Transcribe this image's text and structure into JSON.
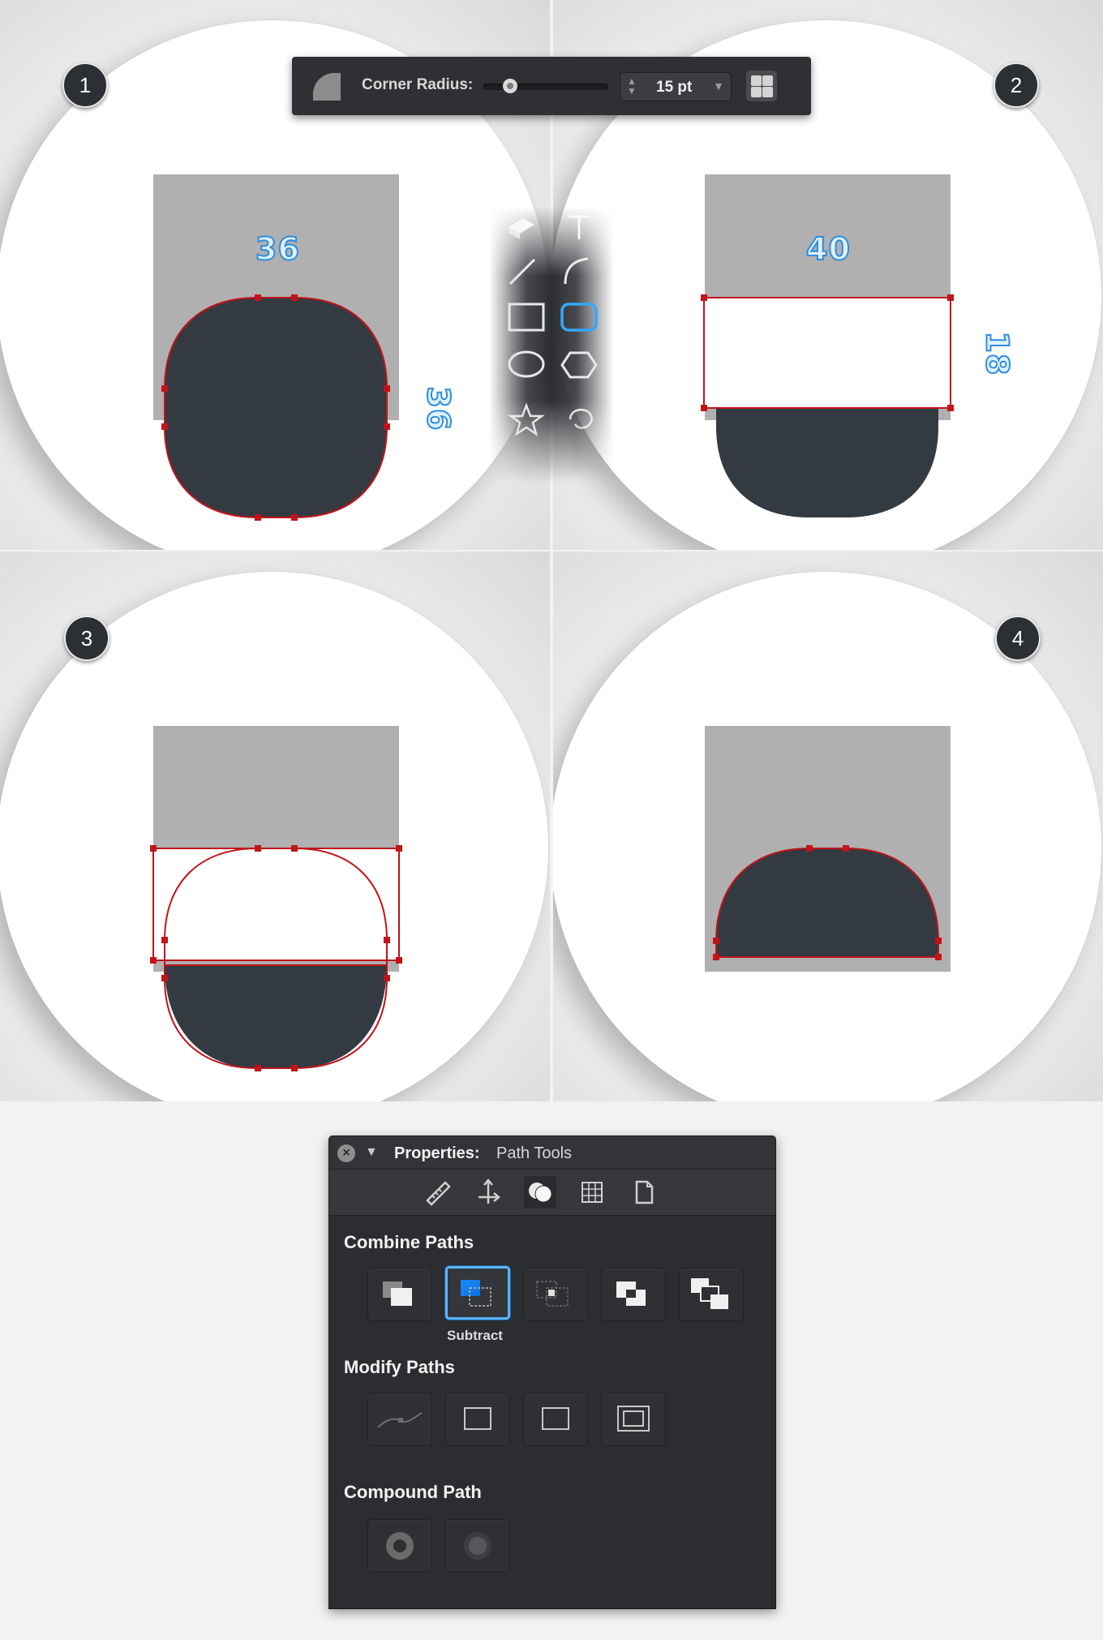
{
  "toolbar": {
    "corner_radius_label": "Corner Radius:",
    "corner_radius_value": "15 pt",
    "corner_radius_slider": 0.18
  },
  "steps": [
    {
      "number": "1",
      "measure_h": "36",
      "measure_v": "36"
    },
    {
      "number": "2",
      "measure_h": "40",
      "measure_v": "18"
    },
    {
      "number": "3"
    },
    {
      "number": "4"
    }
  ],
  "toolstrip": {
    "icons": [
      "eraser-icon",
      "text-tool-icon",
      "line-tool-icon",
      "arc-tool-icon",
      "rectangle-tool-icon",
      "rounded-rectangle-tool-icon",
      "ellipse-tool-icon",
      "polygon-tool-icon",
      "star-tool-icon",
      "spiral-tool-icon"
    ],
    "active": "rounded-rectangle-tool-icon"
  },
  "properties": {
    "title": "Properties:",
    "subtitle": "Path Tools",
    "tabs": [
      "ruler-icon",
      "move-arrows-icon",
      "combine-shapes-icon",
      "grid-icon",
      "document-icon"
    ],
    "active_tab": "combine-shapes-icon",
    "combine_paths": {
      "heading": "Combine Paths",
      "buttons": [
        "union-icon",
        "subtract-icon",
        "intersect-icon",
        "exclude-icon",
        "divide-icon"
      ],
      "selected": "subtract-icon",
      "selected_caption": "Subtract"
    },
    "modify_paths": {
      "heading": "Modify Paths",
      "buttons": [
        "smooth-path-icon",
        "outline-stroke-icon",
        "expand-path-icon",
        "offset-path-icon"
      ]
    },
    "compound_path": {
      "heading": "Compound Path",
      "buttons": [
        "make-compound-icon",
        "release-compound-icon"
      ]
    }
  },
  "colors": {
    "shape_fill": "#343a41",
    "path_outline": "#c0141a",
    "placeholder_grey": "#b0b0b0",
    "accent_blue": "#2e8ee0"
  }
}
